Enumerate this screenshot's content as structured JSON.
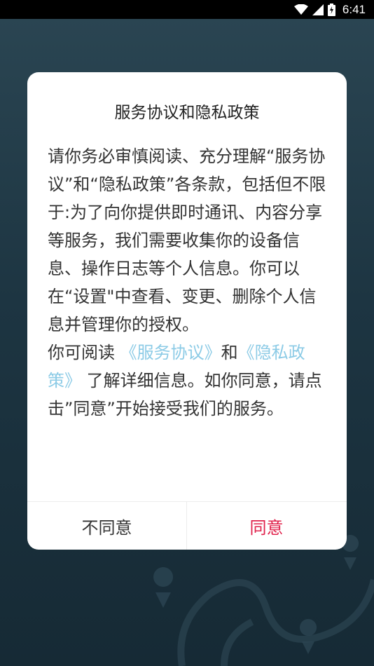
{
  "status_bar": {
    "time": "6:41",
    "icons": [
      "wifi-icon",
      "cell-signal-icon",
      "battery-icon"
    ]
  },
  "dialog": {
    "title": "服务协议和隐私政策",
    "body_part1": "请你务必审慎阅读、充分理解“服务协议”和“隐私政策”各条款，包括但不限于:为了向你提供即时通讯、内容分享等服务，我们需要收集你的设备信息、操作日志等个人信息。你可以在“设置\"中查看、变更、删除个人信息并管理你的授权。",
    "body_part2_prefix": "你可阅读 ",
    "link_service": "《服务协议》",
    "body_and": "和",
    "link_privacy": "《隐私政策》",
    "body_part2_suffix": " 了解详细信息。如你同意，请点击”同意”开始接受我们的服务。",
    "disagree_label": "不同意",
    "agree_label": "同意"
  },
  "colors": {
    "accent_agree": "#e0204a",
    "link": "#8ccbe6",
    "background_top": "#2b4653",
    "background_bottom": "#162a35"
  }
}
